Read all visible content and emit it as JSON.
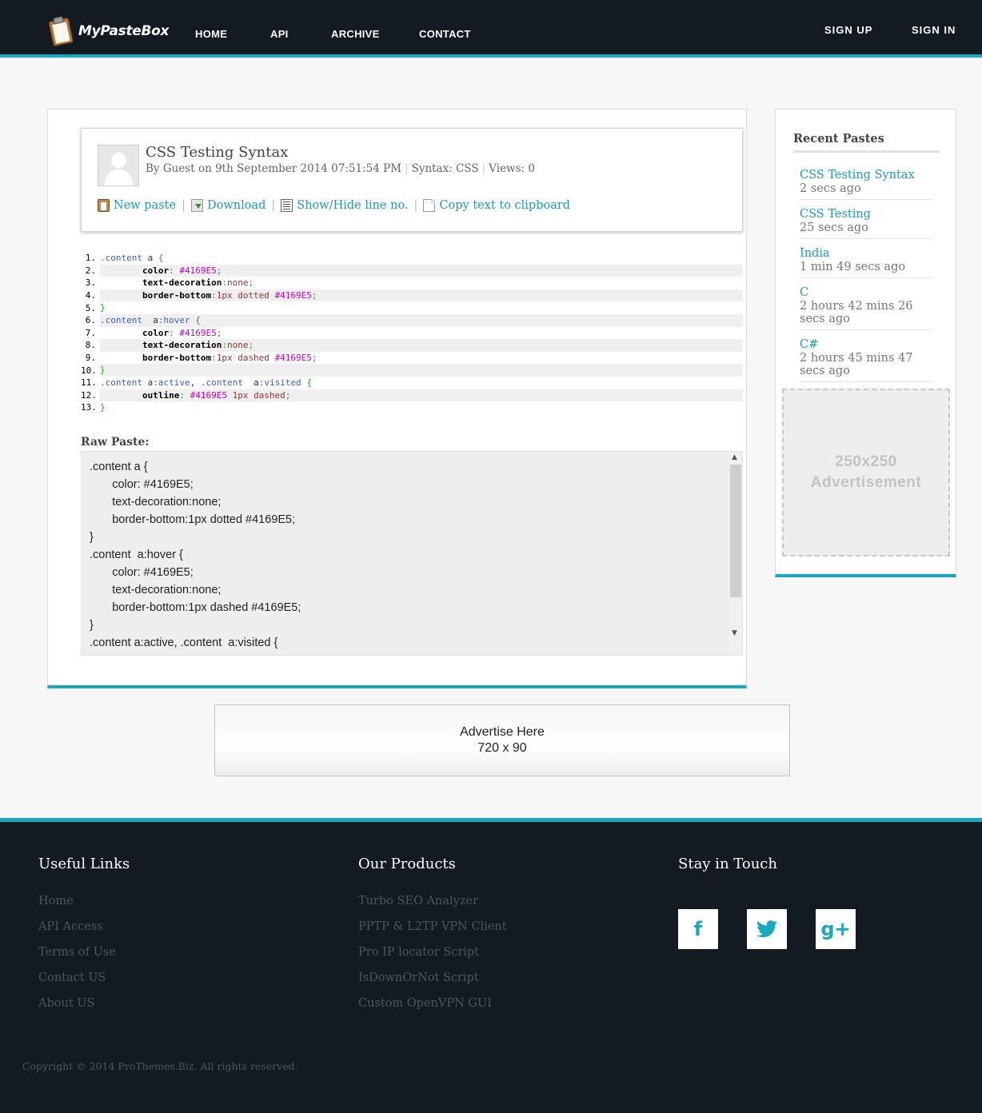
{
  "header": {
    "brand": "MyPasteBox",
    "nav": [
      "HOME",
      "API",
      "ARCHIVE",
      "CONTACT"
    ],
    "sign_up": "SIGN UP",
    "sign_in": "SIGN IN",
    "accent_color": "#14a9bd",
    "bg_color": "#131a21"
  },
  "paste": {
    "title": "CSS Testing Syntax",
    "meta": {
      "author": "By Guest on 9th September 2014 07:51:54 PM",
      "syntax": "Syntax: CSS",
      "views": "Views: 0"
    },
    "actions": {
      "new_paste": "New paste",
      "download": "Download",
      "toggle_lines": "Show/Hide line no.",
      "copy": "Copy text to clipboard"
    },
    "code_lines": [
      ".content a {",
      "\tcolor: #4169E5;",
      "\ttext-decoration:none;",
      "\tborder-bottom:1px dotted #4169E5;",
      "}",
      ".content  a:hover {",
      "\tcolor: #4169E5;",
      "\ttext-decoration:none;",
      "\tborder-bottom:1px dashed #4169E5;",
      "}",
      ".content a:active, .content  a:visited {",
      "\toutline: #4169E5 1px dashed;",
      "}"
    ],
    "raw_label": "Raw Paste:",
    "raw_text": ".content a {\n\tcolor: #4169E5;\n\ttext-decoration:none;\n\tborder-bottom:1px dotted #4169E5;\n}\n.content  a:hover {\n\tcolor: #4169E5;\n\ttext-decoration:none;\n\tborder-bottom:1px dashed #4169E5;\n}\n.content a:active, .content  a:visited {"
  },
  "sidebar": {
    "title": "Recent Pastes",
    "items": [
      {
        "title": "CSS Testing Syntax",
        "time": "2 secs ago"
      },
      {
        "title": "CSS Testing",
        "time": "25 secs ago"
      },
      {
        "title": "India",
        "time": "1 min 49 secs ago"
      },
      {
        "title": "C",
        "time": "2 hours 42 mins 26 secs ago"
      },
      {
        "title": "C#",
        "time": "2 hours 45 mins 47 secs ago"
      }
    ],
    "ad_line1": "250x250",
    "ad_line2": "Advertisement"
  },
  "banner_ad": {
    "line1": "Advertise Here",
    "line2": "720 x 90"
  },
  "footer": {
    "useful_links_title": "Useful Links",
    "useful_links": [
      "Home",
      "API Access",
      "Terms of Use",
      "Contact US",
      "About US"
    ],
    "products_title": "Our Products",
    "products": [
      "Turbo SEO Analyzer",
      "PPTP & L2TP VPN Client",
      "Pro IP locator Script",
      "IsDownOrNot Script",
      "Custom OpenVPN GUI"
    ],
    "stay_title": "Stay in Touch",
    "social": [
      {
        "icon": "facebook-icon",
        "glyph": "f"
      },
      {
        "icon": "twitter-icon",
        "glyph": "t"
      },
      {
        "icon": "google-plus-icon",
        "glyph": "g+"
      }
    ],
    "copyright": "Copyright © 2014 ProThemes.Biz. All rights reserved."
  }
}
